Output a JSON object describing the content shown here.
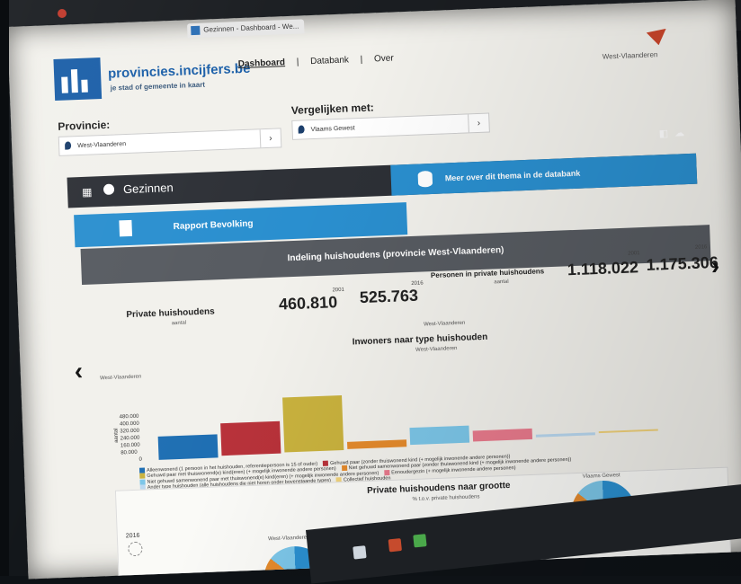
{
  "browser": {
    "tab_title": "Gezinnen - Dashboard - We..."
  },
  "header": {
    "logo_text": "provincies.incijfers.be",
    "logo_sub": "je stad of gemeente in kaart",
    "nav": [
      "Dashboard",
      "|",
      "Databank",
      "|",
      "Over"
    ],
    "brand": "West-Vlaanderen"
  },
  "filters": {
    "provincie_label": "Provincie:",
    "provincie_value": "West-Vlaanderen",
    "vergelijken_label": "Vergelijken met:",
    "vergelijken_value": "Vlaams Gewest"
  },
  "theme": {
    "name": "Gezinnen",
    "more_button": "Meer over dit thema in de databank",
    "report_button": "Rapport Bevolking",
    "section_title": "Indeling huishoudens (provincie West-Vlaanderen)"
  },
  "stats": {
    "private_label": "Private huishoudens",
    "private_sub": "aantal",
    "year_a": "2001",
    "year_b": "2016",
    "private_a": "460.810",
    "private_b": "525.763",
    "personen_label": "Personen in private huishoudens",
    "personen_sub": "aantal",
    "personen_a": "1.118.022",
    "personen_b": "1.175.306"
  },
  "chart1": {
    "region": "West-Vlaanderen",
    "title": "Inwoners naar type huishouden",
    "subtitle": "West-Vlaanderen",
    "yaxis_label": "aantal",
    "yticks": [
      "480.000",
      "400.000",
      "320.000",
      "240.000",
      "160.000",
      "80.000",
      "0"
    ],
    "legend": [
      "Alleenwonend (1 persoon in het huishouden, referentiepersoon is 15 of ouder)",
      "Gehuwd paar (zonder thuiswonend kind (+ mogelijk inwonende andere personen))",
      "Gehuwd paar met thuiswonend(e) kind(eren) (+ mogelijk inwonende andere personen)",
      "Niet gehuwd samenwonend paar (zonder thuiswonend kind (+ mogelijk inwonende andere personen))",
      "Niet gehuwd samenwonend paar met thuiswonend(e) kind(eren) (+ mogelijk inwonende andere personen)",
      "Eenoudergezin (+ mogelijk inwonende andere personen)",
      "Ander type huishouden (alle huishoudens die niet horen onder bovenstaande types)",
      "Collectief huishouden"
    ]
  },
  "chart2": {
    "title": "Private huishoudens naar grootte",
    "subtitle": "% t.o.v. private huishoudens",
    "year": "2016",
    "left_region": "West-Vlaanderen",
    "right_region": "Vlaams Gewest"
  },
  "chart_data": {
    "type": "bar",
    "categories": [
      "Alleenwonend",
      "Gehuwd paar zonder kind",
      "Gehuwd paar met kind",
      "Niet gehuwd zonder kind",
      "Niet gehuwd met kind",
      "Eenoudergezin",
      "Ander type",
      "Collectief"
    ],
    "values": [
      171000,
      242000,
      409000,
      50000,
      128000,
      80000,
      17000,
      17000
    ],
    "colors": [
      "#1f6fb3",
      "#b8323a",
      "#c9b23e",
      "#e48a2c",
      "#7cc6e8",
      "#e87a8c",
      "#b9d8f0",
      "#f1d27a"
    ],
    "ylim": [
      0,
      480000
    ]
  }
}
